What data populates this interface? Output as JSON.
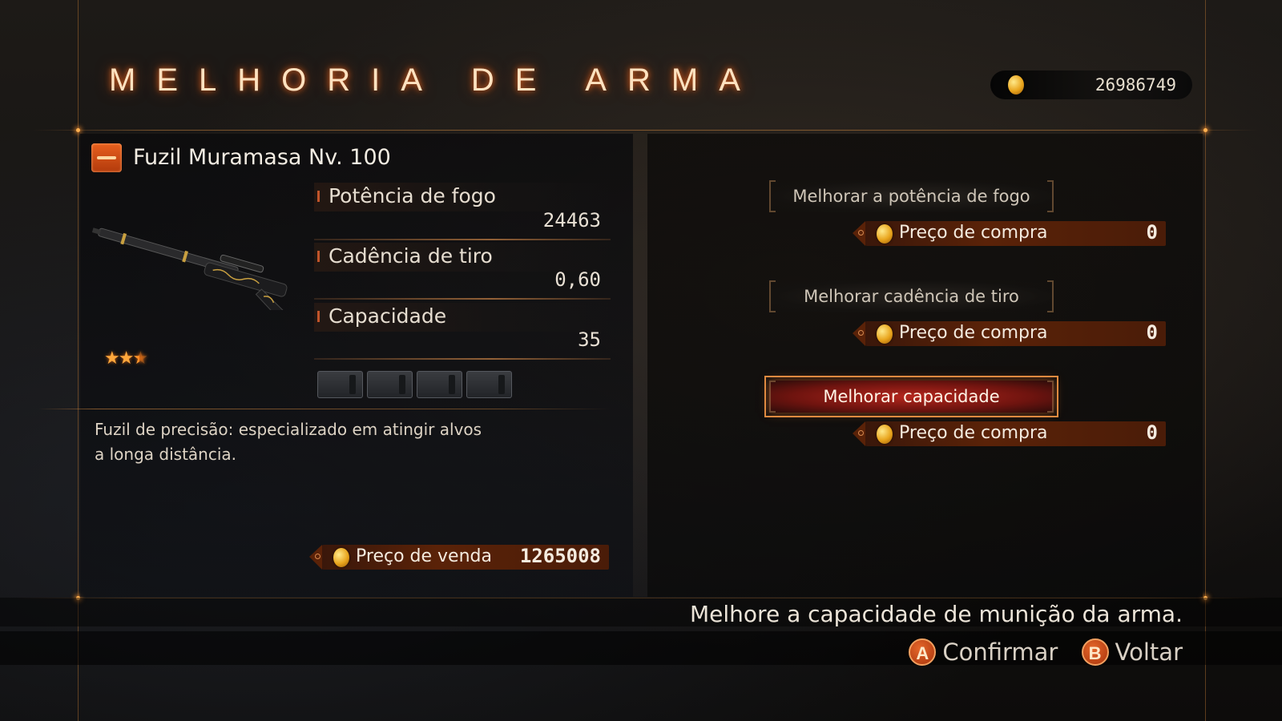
{
  "header": {
    "title": "MELHORIA DE ARMA",
    "money": "26986749"
  },
  "weapon": {
    "name": "Fuzil Muramasa Nv. 100",
    "rating_stars": 2.5,
    "stats": [
      {
        "label": "Potência de fogo",
        "value": "24463"
      },
      {
        "label": "Cadência de tiro",
        "value": "0,60"
      },
      {
        "label": "Capacidade",
        "value": "35"
      }
    ],
    "description_line1": "Fuzil de precisão: especializado em atingir alvos",
    "description_line2": "a longa distância.",
    "sell": {
      "label": "Preço de venda",
      "value": "1265008"
    }
  },
  "upgrades": [
    {
      "label": "Melhorar a potência de fogo",
      "price_label": "Preço de compra",
      "price": "0",
      "selected": false
    },
    {
      "label": "Melhorar cadência de tiro",
      "price_label": "Preço de compra",
      "price": "0",
      "selected": false
    },
    {
      "label": "Melhorar capacidade",
      "price_label": "Preço de compra",
      "price": "0",
      "selected": true
    }
  ],
  "footer": {
    "hint": "Melhore a capacidade de munição da arma.",
    "confirm_key": "A",
    "confirm_label": "Confirmar",
    "back_key": "B",
    "back_label": "Voltar"
  },
  "colors": {
    "accent": "#e08a40",
    "price_bar": "#5a2208",
    "selected": "#be281e"
  }
}
